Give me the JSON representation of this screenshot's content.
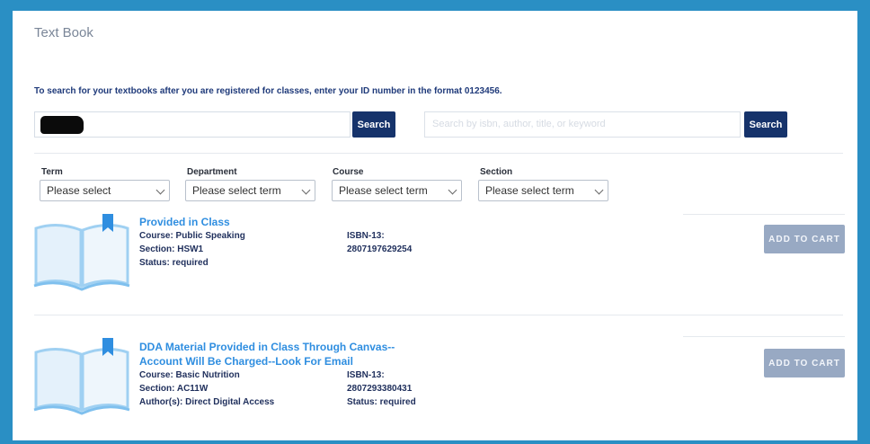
{
  "page": {
    "title": "Text Book",
    "intro": "To search for your textbooks after you are registered for classes, enter your ID number in the format 0123456."
  },
  "search": {
    "id_button": "Search",
    "query_placeholder": "Search by isbn, author, title, or keyword",
    "query_button": "Search"
  },
  "filters": [
    {
      "label": "Term",
      "value": "Please select"
    },
    {
      "label": "Department",
      "value": "Please select term"
    },
    {
      "label": "Course",
      "value": "Please select term"
    },
    {
      "label": "Section",
      "value": "Please select term"
    }
  ],
  "items": [
    {
      "title": "Provided in Class",
      "course": "Course: Public Speaking",
      "section": "Section: HSW1",
      "status": "Status: required",
      "isbn_label": "ISBN-13:",
      "isbn": "2807197629254",
      "cart": "ADD TO CART"
    },
    {
      "title_line1": "DDA Material Provided in Class Through Canvas--",
      "title_line2": "Account Will Be Charged--Look For Email",
      "course": "Course: Basic Nutrition",
      "section": "Section: AC11W",
      "authors": "Author(s): Direct Digital Access",
      "isbn_label": "ISBN-13:",
      "isbn": "2807293380431",
      "status": "Status: required",
      "cart": "ADD TO CART"
    }
  ],
  "colors": {
    "frame": "#2a8fc4",
    "primary_button": "#16336b",
    "link": "#2f8ee0",
    "cart_button": "#98a9c3"
  }
}
